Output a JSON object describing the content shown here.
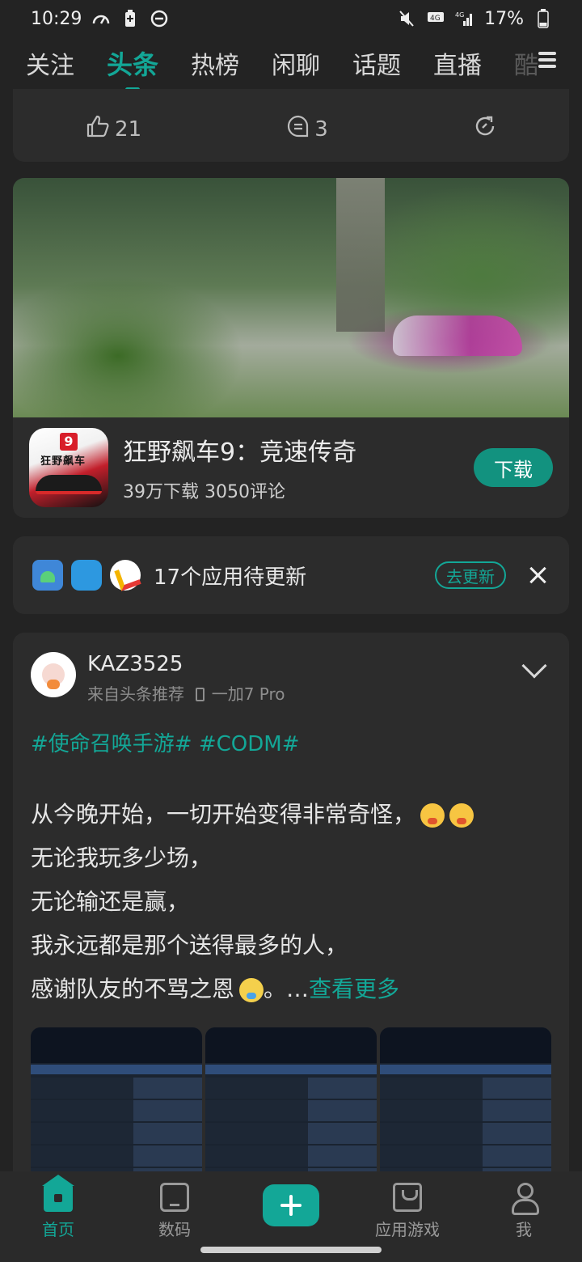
{
  "status_bar": {
    "time": "10:29",
    "battery_percent": "17%",
    "network": "4G"
  },
  "tabs": [
    {
      "label": "关注",
      "active": false
    },
    {
      "label": "头条",
      "active": true
    },
    {
      "label": "热榜",
      "active": false
    },
    {
      "label": "闲聊",
      "active": false
    },
    {
      "label": "话题",
      "active": false
    },
    {
      "label": "直播",
      "active": false
    },
    {
      "label": "酷",
      "active": false
    }
  ],
  "prev_post_actions": {
    "likes": "21",
    "comments": "3"
  },
  "game_card": {
    "title": "狂野飙车9：竞速传奇",
    "meta": "39万下载 3050评论",
    "download_label": "下载",
    "icon_text": "狂野飙车",
    "icon_badge": "9"
  },
  "update_card": {
    "text": "17个应用待更新",
    "button": "去更新"
  },
  "post": {
    "username": "KAZ3525",
    "source": "来自头条推荐",
    "device": "一加7 Pro",
    "hashtags": "#使命召唤手游# #CODM#",
    "lines": [
      "从今晚开始，一切开始变得非常奇怪，",
      "无论我玩多少场，",
      "无论输还是赢，",
      "我永远都是那个送得最多的人，",
      "感谢队友的不骂之恩"
    ],
    "line5_suffix": "。…",
    "more_label": "查看更多"
  },
  "bottom_nav": [
    {
      "label": "首页",
      "active": true
    },
    {
      "label": "数码",
      "active": false
    },
    {
      "label": "应用游戏",
      "active": false
    },
    {
      "label": "我",
      "active": false
    }
  ],
  "colors": {
    "accent": "#13a797",
    "background": "#232323",
    "card": "#2c2c2c"
  }
}
